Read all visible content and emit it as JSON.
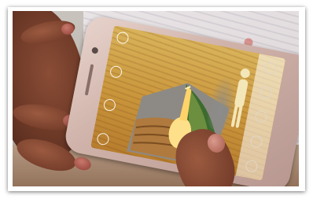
{
  "scene": {
    "subject": "hand-holding-phone-showing-3d-volcano-cross-section"
  },
  "icons": {
    "left_column": [
      "circle-icon",
      "circle-icon",
      "circle-icon",
      "circle-icon"
    ],
    "right_column": [
      "circle-icon",
      "circle-icon",
      "circle-icon",
      "circle-icon",
      "circle-icon"
    ]
  },
  "colors": {
    "screen_background": "#d4a94a",
    "lava": "#ffe08a",
    "phone_body": "#d9bdb5",
    "skin": "#7a412d"
  }
}
